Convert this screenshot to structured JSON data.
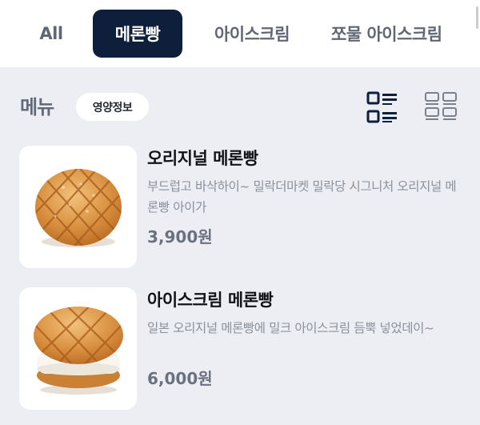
{
  "tabs": [
    {
      "label": "All",
      "active": false
    },
    {
      "label": "메론빵",
      "active": true
    },
    {
      "label": "아이스크림",
      "active": false
    },
    {
      "label": "쪼물 아이스크림",
      "active": false
    }
  ],
  "menu_header": {
    "title": "메뉴",
    "nutrition_label": "영양정보",
    "view_modes": [
      "list-view-icon",
      "grid-view-icon"
    ]
  },
  "items": [
    {
      "name": "오리지널 메론빵",
      "description": "부드럽고 바삭하이~ 밀락더마켓 밀락당 시그니처 오리지널 메론빵 아이가",
      "price": "3,900원",
      "image": "melon-bread-icon"
    },
    {
      "name": "아이스크림 메론빵",
      "description": "일본 오리지널 메론빵에 밀크 아이스크림 듬뿍 넣었데이~",
      "price": "6,000원",
      "image": "ice-cream-melon-bread-icon"
    }
  ],
  "colors": {
    "active_tab_bg": "#0e1f3b",
    "page_bg": "#eceef3",
    "card_bg": "#ffffff",
    "icon_dark": "#0e1f3b"
  }
}
